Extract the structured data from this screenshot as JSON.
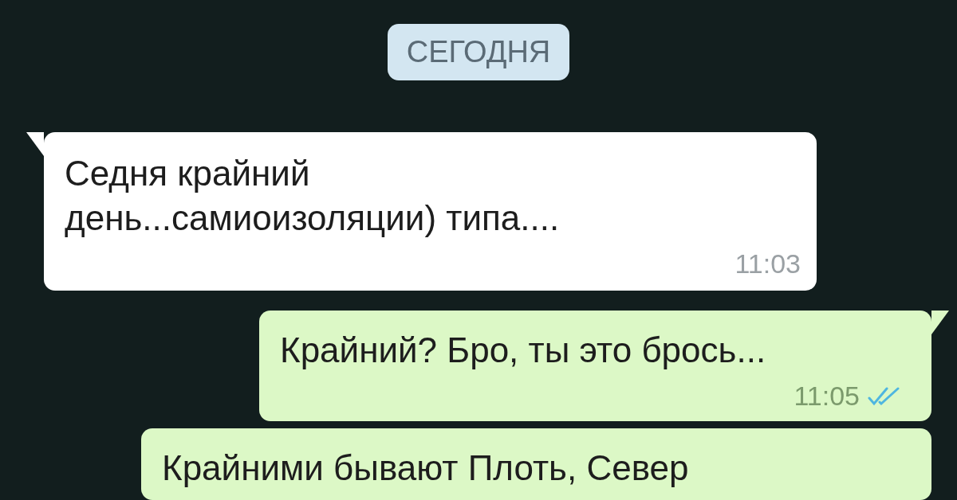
{
  "date_badge": "СЕГОДНЯ",
  "messages": [
    {
      "kind": "in",
      "tail": true,
      "text": "Седня крайний\nдень...самиоизоляции) типа....",
      "time": "11:03"
    },
    {
      "kind": "out",
      "tail": true,
      "text": "Крайний? Бро, ты это брось...",
      "time": "11:05",
      "read": true
    },
    {
      "kind": "out",
      "tail": false,
      "text": "Крайними бывают Плоть, Север"
    }
  ]
}
